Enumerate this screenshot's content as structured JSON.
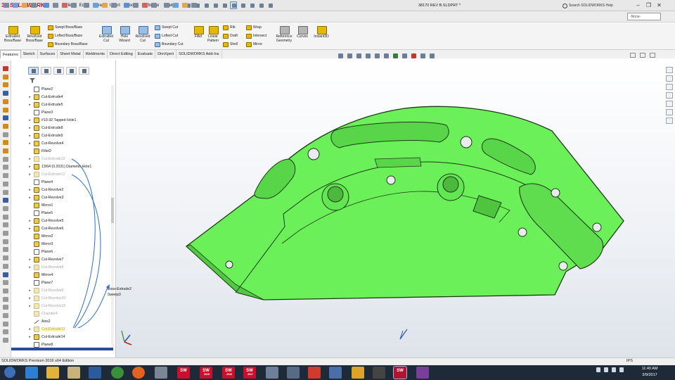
{
  "app": {
    "brand": "SOLIDWORKS",
    "document_title": "38170 REV B.SLDPRT *",
    "search_placeholder": "Search SOLIDWORKS Help",
    "display_state": "-None-",
    "colors": {
      "part_green": "#6cf05a",
      "part_edge": "#1b3a12",
      "brand_red": "#c8102e",
      "taskbar": "#1f2a39"
    }
  },
  "menu": [
    "File",
    "Edit",
    "View",
    "Insert",
    "Tools",
    "Window",
    "Help"
  ],
  "commands": {
    "extruded_boss": "Extruded Boss/Base",
    "revolved_boss": "Revolved Boss/Base",
    "swept_boss": "Swept Boss/Base",
    "lofted_boss": "Lofted Boss/Base",
    "boundary_boss": "Boundary Boss/Base",
    "extruded_cut": "Extruded Cut",
    "hole_wizard": "Hole Wizard",
    "revolved_cut": "Revolved Cut",
    "swept_cut": "Swept Cut",
    "lofted_cut": "Lofted Cut",
    "boundary_cut": "Boundary Cut",
    "fillet": "Fillet",
    "linear_pattern": "Linear Pattern",
    "rib": "Rib",
    "draft": "Draft",
    "shell": "Shell",
    "wrap": "Wrap",
    "intersect": "Intersect",
    "mirror": "Mirror",
    "reference_geometry": "Reference Geometry",
    "curves": "Curves",
    "instant3d": "Instant3D"
  },
  "tabs": [
    "Features",
    "Sketch",
    "Surfaces",
    "Sheet Metal",
    "Weldments",
    "Direct Editing",
    "Evaluate",
    "DimXpert",
    "SOLIDWORKS Add-Ins"
  ],
  "tree": [
    {
      "label": "Plane2",
      "kind": "plane",
      "expand": false,
      "suppressed": false
    },
    {
      "label": "Cut-Extrude4",
      "kind": "cut",
      "expand": true,
      "suppressed": false
    },
    {
      "label": "Cut-Extrude5",
      "kind": "cut",
      "expand": true,
      "suppressed": false
    },
    {
      "label": "Plane3",
      "kind": "plane",
      "expand": false,
      "suppressed": false
    },
    {
      "label": "#10-32 Tapped Hole1",
      "kind": "cut",
      "expand": true,
      "suppressed": false
    },
    {
      "label": "Cut-Extrude8",
      "kind": "cut",
      "expand": true,
      "suppressed": false
    },
    {
      "label": "Cut-Extrude9",
      "kind": "cut",
      "expand": true,
      "suppressed": false
    },
    {
      "label": "Cut-Revolve4",
      "kind": "cut",
      "expand": true,
      "suppressed": false
    },
    {
      "label": "Fillet2",
      "kind": "cut",
      "expand": false,
      "suppressed": false
    },
    {
      "label": "Cut-Extrude10",
      "kind": "cut",
      "expand": true,
      "suppressed": true
    },
    {
      "label": "13/64 (0.2031) Diameter Hole1",
      "kind": "cut",
      "expand": true,
      "suppressed": false
    },
    {
      "label": "Cut-Extrude12",
      "kind": "cut",
      "expand": true,
      "suppressed": true
    },
    {
      "label": "Plane4",
      "kind": "plane",
      "expand": false,
      "suppressed": false
    },
    {
      "label": "Cut-Revolve2",
      "kind": "cut",
      "expand": true,
      "suppressed": false
    },
    {
      "label": "Cut-Revolve3",
      "kind": "cut",
      "expand": true,
      "suppressed": false
    },
    {
      "label": "Mirror1",
      "kind": "cut",
      "expand": false,
      "suppressed": false
    },
    {
      "label": "Plane5",
      "kind": "plane",
      "expand": false,
      "suppressed": false
    },
    {
      "label": "Cut-Revolve5",
      "kind": "cut",
      "expand": true,
      "suppressed": false
    },
    {
      "label": "Cut-Revolve6",
      "kind": "cut",
      "expand": true,
      "suppressed": false
    },
    {
      "label": "Mirror2",
      "kind": "cut",
      "expand": false,
      "suppressed": false
    },
    {
      "label": "Mirror3",
      "kind": "cut",
      "expand": false,
      "suppressed": false
    },
    {
      "label": "Plane6",
      "kind": "plane",
      "expand": false,
      "suppressed": false
    },
    {
      "label": "Cut-Revolve7",
      "kind": "cut",
      "expand": true,
      "suppressed": false
    },
    {
      "label": "Cut-Revolve8",
      "kind": "cut",
      "expand": true,
      "suppressed": true
    },
    {
      "label": "Mirror4",
      "kind": "cut",
      "expand": false,
      "suppressed": false
    },
    {
      "label": "Plane7",
      "kind": "plane",
      "expand": false,
      "suppressed": false
    },
    {
      "label": "Cut-Revolve9",
      "kind": "cut",
      "expand": true,
      "suppressed": true
    },
    {
      "label": "Cut-Revolve10",
      "kind": "cut",
      "expand": true,
      "suppressed": true
    },
    {
      "label": "Cut-Revolve15",
      "kind": "cut",
      "expand": true,
      "suppressed": true
    },
    {
      "label": "Chamfer4",
      "kind": "cut",
      "expand": false,
      "suppressed": true
    },
    {
      "label": "Axis2",
      "kind": "axis",
      "expand": false,
      "suppressed": false
    },
    {
      "label": "Cut-Extrude13",
      "kind": "cut",
      "expand": true,
      "suppressed": true,
      "highlight": true
    },
    {
      "label": "Cut-Extrude14",
      "kind": "cut",
      "expand": true,
      "suppressed": false
    },
    {
      "label": "Plane8",
      "kind": "plane",
      "expand": false,
      "suppressed": false
    }
  ],
  "drag_popover": {
    "line1": "Boss-Extrude2",
    "line2": "Sweep3"
  },
  "status": {
    "edition": "SOLIDWORKS Premium 2016 x64 Edition",
    "units": "IPS"
  },
  "taskbar": {
    "time": "11:40 AM",
    "date": "3/9/2017",
    "labels": [
      "2015",
      "2016",
      "2017"
    ]
  }
}
